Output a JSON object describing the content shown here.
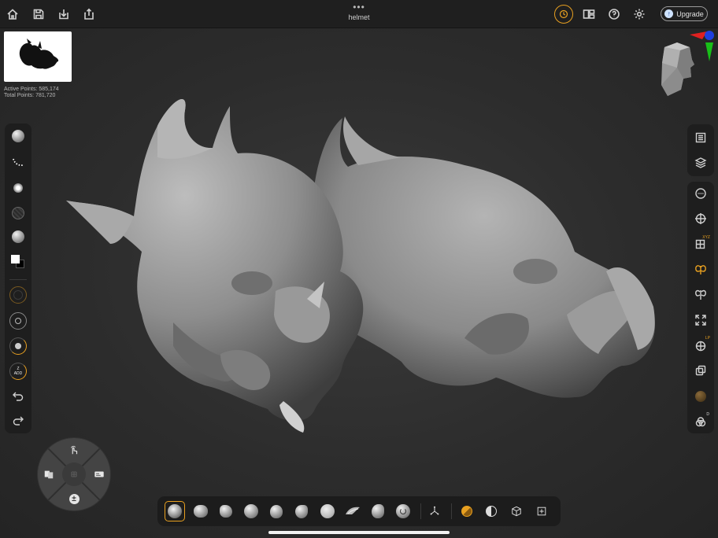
{
  "document": {
    "title": "helmet",
    "menu_dots": "•••"
  },
  "topbar": {
    "left_icons": [
      "home-icon",
      "save-icon",
      "import-icon",
      "share-icon"
    ],
    "right_icons": [
      "history-icon",
      "scene-layout-icon",
      "help-icon",
      "settings-icon"
    ],
    "upgrade_label": "Upgrade"
  },
  "stats": {
    "active_points": "Active Points: 585,174",
    "total_points": "Total Points: 781,720"
  },
  "left_toolbar": {
    "items": [
      "brush-icon",
      "stroke-icon",
      "alpha-icon",
      "texture-icon",
      "material-icon",
      "color-icon",
      "size-icon",
      "focal-shift-icon",
      "intensity-icon",
      "zadd-icon",
      "undo-icon",
      "redo-icon"
    ],
    "zadd_label": "Z\nADD"
  },
  "right_toolbar": {
    "items": [
      "document-icon",
      "layers-icon",
      "dynamesh-icon",
      "transform-icon",
      "grid-icon",
      "symmetry-icon",
      "mirror-icon",
      "frame-icon",
      "perspective-icon",
      "subtool-icon",
      "material-ball-icon",
      "polypaint-icon"
    ],
    "badges": {
      "grid": "XYZ",
      "perspective": "LP",
      "polypaint": "D"
    }
  },
  "bottom_toolbar": {
    "brushes": [
      "standard-brush",
      "clay-brush",
      "claybuildup-brush",
      "move-brush",
      "damstandard-brush",
      "trimdynamic-brush",
      "inflate-brush",
      "snakehook-brush",
      "hpolish-brush",
      "curve-brush"
    ],
    "tools": [
      "gizmo-icon",
      "draw-mode-icon",
      "smooth-mode-icon",
      "mesh-icon",
      "add-icon"
    ]
  },
  "pie_menu": {
    "items": [
      "touch-icon",
      "actions-icon",
      "grid-icon",
      "masks-icon",
      "plusminus-icon"
    ]
  },
  "colors": {
    "accent": "#e8a020",
    "panel": "#1e1e1e",
    "background": "#2c2c2c"
  }
}
